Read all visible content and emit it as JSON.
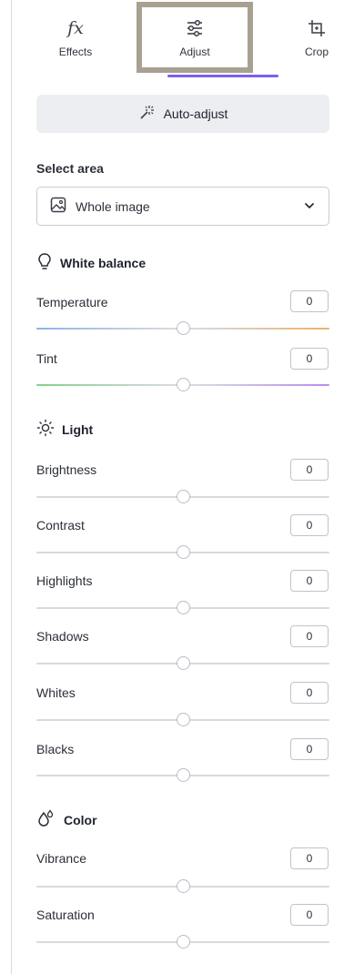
{
  "tabs": [
    {
      "label": "Effects",
      "icon": "fx-icon"
    },
    {
      "label": "Adjust",
      "icon": "sliders-icon",
      "active": true
    },
    {
      "label": "Crop",
      "icon": "crop-icon"
    }
  ],
  "tabs_icon_text": {
    "fx": "fx"
  },
  "auto_adjust": {
    "label": "Auto-adjust",
    "icon": "magic-wand-icon"
  },
  "select_area": {
    "label": "Select area",
    "value": "Whole image",
    "icon": "image-icon"
  },
  "sections": {
    "white_balance": {
      "title": "White balance",
      "icon": "lightbulb-icon"
    },
    "light": {
      "title": "Light",
      "icon": "sun-icon"
    },
    "color": {
      "title": "Color",
      "icon": "color-drops-icon"
    }
  },
  "sliders": {
    "temperature": {
      "label": "Temperature",
      "value": "0"
    },
    "tint": {
      "label": "Tint",
      "value": "0"
    },
    "brightness": {
      "label": "Brightness",
      "value": "0"
    },
    "contrast": {
      "label": "Contrast",
      "value": "0"
    },
    "highlights": {
      "label": "Highlights",
      "value": "0"
    },
    "shadows": {
      "label": "Shadows",
      "value": "0"
    },
    "whites": {
      "label": "Whites",
      "value": "0"
    },
    "blacks": {
      "label": "Blacks",
      "value": "0"
    },
    "vibrance": {
      "label": "Vibrance",
      "value": "0"
    },
    "saturation": {
      "label": "Saturation",
      "value": "0"
    }
  },
  "colors": {
    "accent": "#7d5ff5",
    "highlight_frame": "#a8a092",
    "button_bg": "#eceef1"
  }
}
